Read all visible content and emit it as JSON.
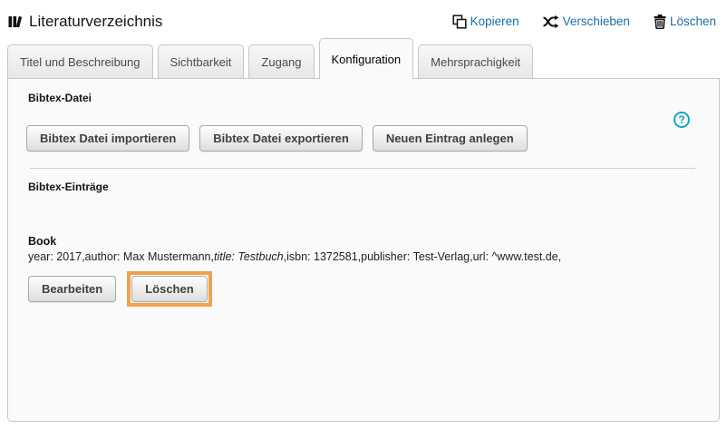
{
  "header": {
    "title": "Literaturverzeichnis",
    "actions": [
      {
        "label": "Kopieren"
      },
      {
        "label": "Verschieben"
      },
      {
        "label": "Löschen"
      }
    ]
  },
  "tabs": [
    {
      "label": "Titel und Beschreibung",
      "active": false
    },
    {
      "label": "Sichtbarkeit",
      "active": false
    },
    {
      "label": "Zugang",
      "active": false
    },
    {
      "label": "Konfiguration",
      "active": true
    },
    {
      "label": "Mehrsprachigkeit",
      "active": false
    }
  ],
  "content": {
    "file_section": {
      "heading": "Bibtex-Datei",
      "buttons": {
        "import": "Bibtex Datei importieren",
        "export": "Bibtex Datei exportieren",
        "new_entry": "Neuen Eintrag anlegen"
      },
      "help_glyph": "?"
    },
    "entries_section": {
      "heading": "Bibtex-Einträge",
      "entry": {
        "type": "Book",
        "detail_prefix": "year: 2017,author: Max Mustermann,",
        "detail_italic": "title: Testbuch",
        "detail_suffix": ",isbn: 1372581,publisher: Test-Verlag,url: ^www.test.de,",
        "buttons": {
          "edit": "Bearbeiten",
          "delete": "Löschen"
        }
      }
    }
  },
  "colors": {
    "link_blue": "#1b6ea8",
    "highlight_orange": "#f0a24c",
    "help_teal": "#16a5c6",
    "panel_background": "#fafafa"
  }
}
